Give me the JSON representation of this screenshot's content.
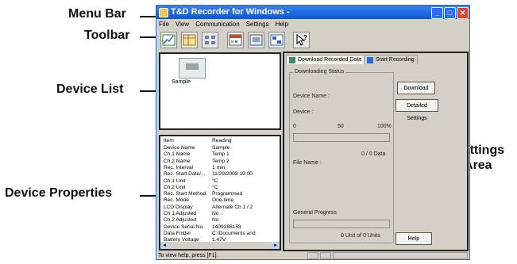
{
  "callouts": {
    "menu_bar": "Menu Bar",
    "toolbar": "Toolbar",
    "device_list": "Device List",
    "device_properties": "Device Properties",
    "settings_area_line1": "Settings",
    "settings_area_line2": "Area"
  },
  "window": {
    "title": "T&D Recorder for Windows -",
    "min_glyph": "_",
    "max_glyph": "□",
    "close_glyph": "✕"
  },
  "menu": [
    "File",
    "View",
    "Communication",
    "Settings",
    "Help"
  ],
  "toolbar_icons": [
    "graph-icon",
    "table-icon",
    "list-icon",
    "calendar-icon",
    "download-icon",
    "grid-icon",
    "help-cursor-icon"
  ],
  "device_list": {
    "items": [
      {
        "label": "Sample"
      }
    ]
  },
  "properties": {
    "header": {
      "item": "Item",
      "reading": "Reading"
    },
    "rows": [
      {
        "k": "Device Name",
        "v": "Sample"
      },
      {
        "k": "Ch.1 Name",
        "v": "Temp 1"
      },
      {
        "k": "Ch.2 Name",
        "v": "Temp 2"
      },
      {
        "k": "Rec. Interval",
        "v": "1 min."
      },
      {
        "k": "Rec. Start Date/...",
        "v": "11/29/2003 19:00"
      },
      {
        "k": "Ch.1 Unit",
        "v": "°C"
      },
      {
        "k": "Ch.2 Unit",
        "v": "°C"
      },
      {
        "k": "Rec. Start Method",
        "v": "Programmed"
      },
      {
        "k": "Rec. Mode",
        "v": "One-time"
      },
      {
        "k": "LCD Display",
        "v": "Alternate Ch 1 / 2"
      },
      {
        "k": "Ch.1 Adjusted",
        "v": "No"
      },
      {
        "k": "Ch.2 Adjusted",
        "v": "No"
      },
      {
        "k": "Device Serial No.",
        "v": "1409286153"
      },
      {
        "k": "Data Folder",
        "v": "C:\\Documents and"
      },
      {
        "k": "Battery Voltage",
        "v": "1.47V"
      }
    ]
  },
  "settings": {
    "tabs": [
      "Download Recorded Data",
      "Start Recording"
    ],
    "group_title": "Downloading Status",
    "device_name_label": "Device Name :",
    "device_label": "Device :",
    "scale": {
      "min": "0",
      "mid": "50",
      "max": "100%"
    },
    "download_progress": 0,
    "data_count": "0 / 0 Data",
    "file_name_label": "File Name :",
    "general_progress_label": "General Progress",
    "general_progress": 0,
    "units": "0 Unit of 0 Units",
    "buttons": {
      "download": "Download",
      "detailed": "Detailed Settings",
      "help": "Help"
    }
  },
  "statusbar": {
    "text": "To view help, press [F1]."
  },
  "colors": {
    "titlebar": "#0a55d8",
    "window_bg": "#d4d0c8",
    "close": "#d84a2a"
  }
}
